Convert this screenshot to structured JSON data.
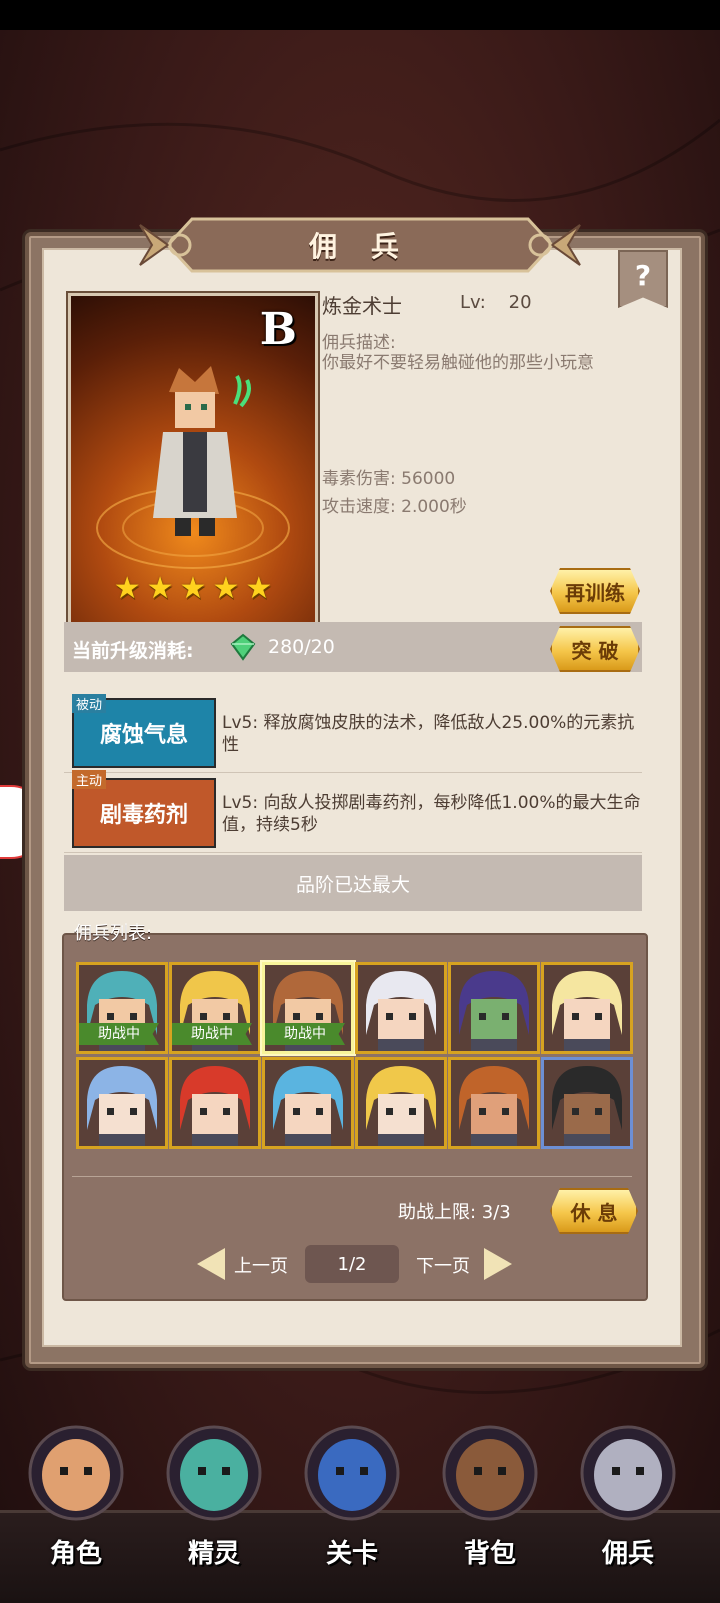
{
  "panel": {
    "title": "佣 兵",
    "help_label": "?"
  },
  "mercenary": {
    "grade": "B",
    "stars": 5,
    "name": "炼金术士",
    "level_label": "Lv:",
    "level": "20",
    "desc_label": "佣兵描述:",
    "description": "你最好不要轻易触碰他的那些小玩意",
    "stat_poison": "毒素伤害: 56000",
    "stat_speed": "攻击速度: 2.000秒",
    "retrain_label": "再训练",
    "cost_label": "当前升级消耗:",
    "cost_value": "280/20",
    "breakthrough_label": "突 破"
  },
  "skills": [
    {
      "tag": "被动",
      "name": "腐蚀气息",
      "desc": "Lv5: 释放腐蚀皮肤的法术，降低敌人25.00%的元素抗性",
      "color": "#1e84a8",
      "tag_color": "#2a7fa0"
    },
    {
      "tag": "主动",
      "name": "剧毒药剂",
      "desc": "Lv5: 向敌人投掷剧毒药剂，每秒降低1.00%的最大生命值，持续5秒",
      "color": "#c0582a",
      "tag_color": "#c36a2c"
    }
  ],
  "grade_max_label": "品阶已达最大",
  "list": {
    "label": "佣兵列表:",
    "assist_badge": "助战中",
    "items": [
      {
        "name": "merc-teal-hair",
        "assist": true,
        "selected": false,
        "hair": "#4fb0b8",
        "skin": "#f2c9a4",
        "frame": "gold"
      },
      {
        "name": "merc-blonde-knight",
        "assist": true,
        "selected": false,
        "hair": "#f0c64a",
        "skin": "#f2c9a4",
        "frame": "gold"
      },
      {
        "name": "merc-alchemist",
        "assist": true,
        "selected": true,
        "hair": "#b0683a",
        "skin": "#f2c9a4",
        "frame": "gold"
      },
      {
        "name": "merc-white-witch",
        "assist": false,
        "selected": false,
        "hair": "#e8e8f0",
        "skin": "#f5d6c0",
        "frame": "gold"
      },
      {
        "name": "merc-purple-mage",
        "assist": false,
        "selected": false,
        "hair": "#4a3a8c",
        "skin": "#7ab070",
        "frame": "gold"
      },
      {
        "name": "merc-demon-girl",
        "assist": false,
        "selected": false,
        "hair": "#f5e6a0",
        "skin": "#f5d6c0",
        "frame": "gold"
      },
      {
        "name": "merc-ice-maiden",
        "assist": false,
        "selected": false,
        "hair": "#8cb4e6",
        "skin": "#f5e0d0",
        "frame": "gold"
      },
      {
        "name": "merc-red-hair",
        "assist": false,
        "selected": false,
        "hair": "#d83a2a",
        "skin": "#f5d6c0",
        "frame": "gold"
      },
      {
        "name": "merc-elf-priestess",
        "assist": false,
        "selected": false,
        "hair": "#5ab4e0",
        "skin": "#f5d6c0",
        "frame": "gold"
      },
      {
        "name": "merc-feather-girl",
        "assist": false,
        "selected": false,
        "hair": "#f0c84a",
        "skin": "#f5e0d0",
        "frame": "gold"
      },
      {
        "name": "merc-dwarf",
        "assist": false,
        "selected": false,
        "hair": "#c0642a",
        "skin": "#e0a07a",
        "frame": "gold"
      },
      {
        "name": "merc-dark-warrior",
        "assist": false,
        "selected": false,
        "hair": "#2a2a2a",
        "skin": "#9a6a4a",
        "frame": "blue"
      }
    ],
    "assist_limit": "助战上限: 3/3",
    "rest_label": "休 息",
    "prev_label": "上一页",
    "next_label": "下一页",
    "page": "1/2"
  },
  "nav": [
    {
      "label": "角色",
      "icon": "hero-icon"
    },
    {
      "label": "精灵",
      "icon": "spirit-icon"
    },
    {
      "label": "关卡",
      "icon": "stage-icon"
    },
    {
      "label": "背包",
      "icon": "backpack-icon"
    },
    {
      "label": "佣兵",
      "icon": "mercenary-icon"
    }
  ]
}
